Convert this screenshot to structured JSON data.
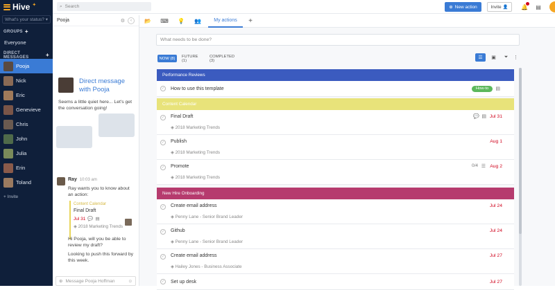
{
  "app": {
    "name": "Hive"
  },
  "sidebar": {
    "status_placeholder": "What's your status?",
    "groups_label": "GROUPS",
    "groups": [
      {
        "label": "Everyone"
      }
    ],
    "dm_label": "DIRECT MESSAGES",
    "contacts": [
      {
        "label": "Pooja",
        "color": "#5a4a40"
      },
      {
        "label": "Nick",
        "color": "#8a6a55"
      },
      {
        "label": "Eric",
        "color": "#a07a5a"
      },
      {
        "label": "Genevieve",
        "color": "#7a5548"
      },
      {
        "label": "Chris",
        "color": "#6a5a50"
      },
      {
        "label": "John",
        "color": "#4f6a4a"
      },
      {
        "label": "Julia",
        "color": "#7a8a5a"
      },
      {
        "label": "Erin",
        "color": "#8a5a4a"
      },
      {
        "label": "Toland",
        "color": "#9a7a60"
      }
    ],
    "invite_label": "+ Invite"
  },
  "topbar": {
    "search_placeholder": "Search",
    "new_action_label": "New action",
    "invite_label": "Invite"
  },
  "dm_panel": {
    "title": "Pooja",
    "intro_title": "Direct message with Pooja",
    "quiet_text": "Seems a little quiet here... Let's get the conversation going!",
    "message": {
      "sender": "Ray",
      "time": "10:03 am",
      "text": "Ray wants you to know about an action:",
      "card": {
        "project": "Content Calendar",
        "title": "Final Draft",
        "date": "Jul 31",
        "tag": "2018 Marketing Trends"
      }
    },
    "reply_1": "Hi Pooja, will you be able to review my draft?",
    "reply_2": "Looking to push this forward by this week.",
    "compose_placeholder": "Message Pooja Hoffman"
  },
  "tabs": [
    {
      "label": "My actions",
      "active": true
    }
  ],
  "main": {
    "input_placeholder": "What needs to be done?",
    "filters": [
      {
        "label": "NOW (8)",
        "active": true
      },
      {
        "label": "FUTURE (1)",
        "active": false
      },
      {
        "label": "COMPLETED (3)",
        "active": false
      }
    ],
    "groups": [
      {
        "title": "Performance Reviews",
        "color": "#3b5bbf",
        "text_color": "#ffffff",
        "rows": [
          {
            "title": "How to use this template",
            "badge": "How-to"
          }
        ]
      },
      {
        "title": "Content Calendar",
        "color": "#e8e37a",
        "text_color": "#ffffff",
        "rows": [
          {
            "title": "Final Draft",
            "sub": "2018 Marketing Trends",
            "date": "Jul 31"
          },
          {
            "title": "Publish",
            "sub": "2018 Marketing Trends",
            "date": "Aug 1"
          },
          {
            "title": "Promote",
            "sub": "2018 Marketing Trends",
            "date": "Aug 2",
            "count": "0/4"
          }
        ]
      },
      {
        "title": "New Hire Onboarding",
        "color": "#b63b6e",
        "text_color": "#ffffff",
        "rows": [
          {
            "title": "Create email address",
            "sub": "Penny Lane - Senior Brand Leader",
            "date": "Jul 24"
          },
          {
            "title": "Github",
            "sub": "Penny Lane - Senior Brand Leader",
            "date": "Jul 24"
          },
          {
            "title": "Create email address",
            "sub": "Hailey Jones - Business Associate",
            "date": "Jul 27"
          },
          {
            "title": "Set up desk",
            "date": "Jul 27"
          }
        ]
      }
    ]
  }
}
